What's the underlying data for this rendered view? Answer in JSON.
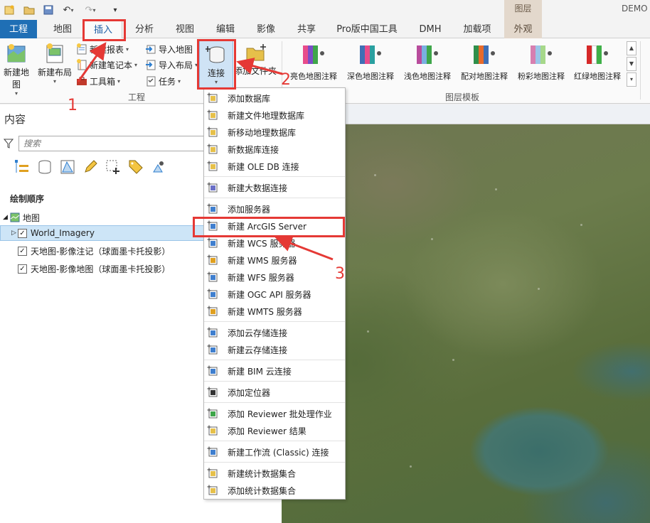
{
  "titlebar": {
    "right_text": "DEMO"
  },
  "tabs": {
    "file": "工程",
    "items": [
      "地图",
      "插入",
      "分析",
      "视图",
      "编辑",
      "影像",
      "共享",
      "Pro版中国工具",
      "DMH",
      "加载项"
    ],
    "context_group": "图层",
    "context_tab": "外观",
    "active": "插入"
  },
  "ribbon": {
    "project_group": {
      "label": "工程",
      "new_map": "新建地图",
      "new_layout": "新建布局",
      "new_report": "新建报表",
      "new_notebook": "新建笔记本",
      "toolbox": "工具箱",
      "import_map": "导入地图",
      "import_layout": "导入布局",
      "tasks": "任务",
      "connect": "连接",
      "add_folder": "添加文件夹"
    },
    "layer_templates": {
      "label": "图层模板",
      "items": [
        {
          "label": "亮色地图注释",
          "colors": [
            "#e84c8b",
            "#7b4dc7",
            "#3fa64a"
          ]
        },
        {
          "label": "深色地图注释",
          "colors": [
            "#3f6fb5",
            "#e84c8b",
            "#2aa0a0"
          ]
        },
        {
          "label": "浅色地图注释",
          "colors": [
            "#b84c9c",
            "#7ab0e0",
            "#3fa64a"
          ]
        },
        {
          "label": "配对地图注释",
          "colors": [
            "#2f8f4a",
            "#e86a2a",
            "#3f6fb5"
          ]
        },
        {
          "label": "粉彩地图注释",
          "colors": [
            "#d77fb0",
            "#9bc6e8",
            "#a6d88a"
          ]
        },
        {
          "label": "红绿地图注释",
          "colors": [
            "#d62828",
            "#ffffff",
            "#3fb048"
          ]
        }
      ]
    }
  },
  "contents": {
    "title": "内容",
    "search_placeholder": "搜索",
    "draw_order": "绘制顺序",
    "map_name": "地图",
    "layers": [
      {
        "name": "World_Imagery",
        "checked": true,
        "selected": true
      },
      {
        "name": "天地图-影像注记（球面墨卡托投影）",
        "checked": true,
        "selected": false
      },
      {
        "name": "天地图-影像地图（球面墨卡托投影）",
        "checked": true,
        "selected": false
      }
    ]
  },
  "menu": {
    "items": [
      "添加数据库",
      "新建文件地理数据库",
      "新移动地理数据库",
      "新数据库连接",
      "新建 OLE DB 连接",
      "新建大数据连接",
      "添加服务器",
      "新建 ArcGIS Server",
      "新建 WCS 服务器",
      "新建 WMS 服务器",
      "新建 WFS 服务器",
      "新建 OGC API 服务器",
      "新建 WMTS 服务器",
      "添加云存储连接",
      "新建云存储连接",
      "新建 BIM 云连接",
      "添加定位器",
      "添加 Reviewer 批处理作业",
      "添加 Reviewer 结果",
      "新建工作流 (Classic) 连接",
      "新建统计数据集合",
      "添加统计数据集合"
    ],
    "highlighted": "新建 ArcGIS Server"
  },
  "annotations": {
    "step1": "1",
    "step2": "2",
    "step3": "3",
    "color": "#e53935"
  }
}
